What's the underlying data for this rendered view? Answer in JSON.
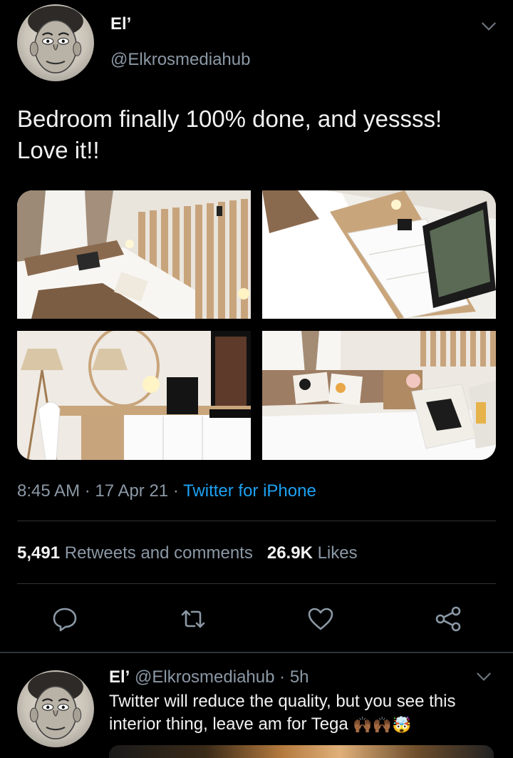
{
  "tweet": {
    "display_name": "El’",
    "handle": "@Elkrosmediahub",
    "text_line1": "Bedroom finally 100% done, and yessss!",
    "text_line2": "Love it!!",
    "media": [
      {
        "name": "bedroom-photo-1",
        "icon": "photo"
      },
      {
        "name": "bedroom-photo-2",
        "icon": "photo"
      },
      {
        "name": "bedroom-photo-3",
        "icon": "photo"
      },
      {
        "name": "bedroom-photo-4",
        "icon": "photo"
      }
    ],
    "time": "8:45 AM",
    "date": "17 Apr 21",
    "separator": "·",
    "source": "Twitter for iPhone",
    "retweets_count": "5,491",
    "retweets_label": "Retweets and comments",
    "likes_count": "26.9K",
    "likes_label": "Likes",
    "actions": {
      "reply_icon": "reply-icon",
      "retweet_icon": "retweet-icon",
      "like_icon": "heart-icon",
      "share_icon": "share-icon"
    }
  },
  "reply": {
    "display_name": "El’",
    "handle": "@Elkrosmediahub",
    "separator": "·",
    "age": "5h",
    "text_line1": "Twitter will reduce the quality, but you see this",
    "text_line2": "interior thing, leave am for Tega",
    "emojis": "🙌🏾🙌🏾🤯"
  },
  "colors": {
    "background": "#000000",
    "text_primary": "#f2f2f2",
    "text_secondary": "#8b98a5",
    "link": "#1da1f2",
    "divider": "#2f3336"
  }
}
